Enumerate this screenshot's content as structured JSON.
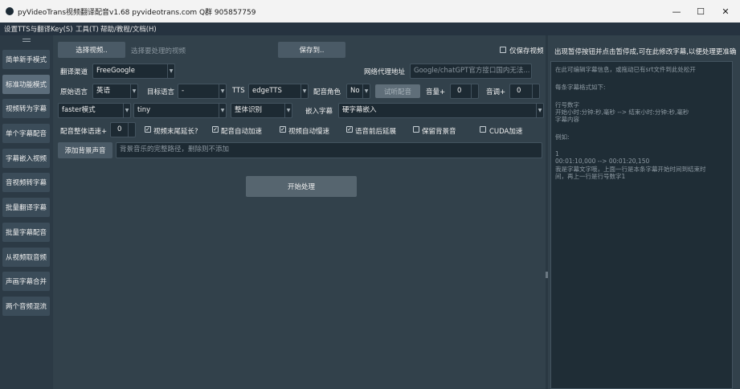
{
  "window": {
    "title": "pyVideoTrans视频翻译配音v1.68 pyvideotrans.com  Q群 905857759",
    "minimize": "—",
    "maximize": "☐",
    "close": "✕"
  },
  "menu": [
    "设置TTS与翻译Key(S)",
    "工具(T)",
    "帮助/教程/文档(H)"
  ],
  "sidebar": {
    "items": [
      {
        "label": "简单新手模式",
        "active": false
      },
      {
        "label": "标准功能模式",
        "active": true
      },
      {
        "label": "视频转为字幕",
        "active": false
      },
      {
        "label": "单个字幕配音",
        "active": false
      },
      {
        "label": "字幕嵌入视频",
        "active": false
      },
      {
        "label": "音视频转字幕",
        "active": false
      },
      {
        "label": "批量翻译字幕",
        "active": false
      },
      {
        "label": "批量字幕配音",
        "active": false
      },
      {
        "label": "从视频取音频",
        "active": false
      },
      {
        "label": "声画字幕合并",
        "active": false
      },
      {
        "label": "两个音频混流",
        "active": false
      }
    ]
  },
  "main": {
    "select_video_btn": "选择视频..",
    "select_video_hint": "选择要处理的视频",
    "save_to_btn": "保存到..",
    "save_only_label": "仅保存视频",
    "translate_channel_label": "翻译渠道",
    "translate_channel_value": "FreeGoogle",
    "proxy_label": "网络代理地址",
    "proxy_placeholder": "Google/chatGPT官方接口国内无法...",
    "source_lang_label": "原始语言",
    "source_lang_value": "英语",
    "target_lang_label": "目标语言",
    "target_lang_value": "-",
    "tts_label": "TTS",
    "tts_value": "edgeTTS",
    "voice_role_label": "配音角色",
    "voice_role_value": "No",
    "listen_btn": "试听配音",
    "volume_label": "音量+",
    "volume_value": "0",
    "pitch_label": "音调+",
    "pitch_value": "0",
    "whisper_mode_value": "faster模式",
    "model_value": "tiny",
    "recognition_value": "整体识别",
    "embed_sub_label": "嵌入字幕",
    "embed_sub_value": "硬字幕嵌入",
    "speed_label": "配音整体语速+",
    "speed_value": "0",
    "checkboxes": [
      {
        "label": "视频末尾延长?",
        "checked": true
      },
      {
        "label": "配音自动加速",
        "checked": true
      },
      {
        "label": "视频自动慢速",
        "checked": true
      },
      {
        "label": "语音前后延展",
        "checked": true
      },
      {
        "label": "保留背景音",
        "checked": false
      },
      {
        "label": "CUDA加速",
        "checked": false
      }
    ],
    "add_bgm_btn": "添加背景声音",
    "bgm_placeholder": "背景音乐的完整路径，删除则不添加",
    "start_btn": "开始处理"
  },
  "right": {
    "header": "出现暂停按钮并点击暂停成,可在此修改字幕,以便处理更准确",
    "editor_lines": [
      "在此可编辑字幕信息，或拖动已有srt文件到此处松开",
      "",
      "每条字幕格式如下:",
      "",
      "行号数字",
      "开始小时:分钟:秒,毫秒 --> 结束小时:分钟:秒,毫秒",
      "字幕内容",
      "",
      "例如:",
      "",
      "1",
      "00:01:10,000 --> 00:01:20,150",
      "我是字幕文字哦，上面一行是本条字幕开始时间到结束时",
      "间，再上一行是行号数字1"
    ]
  }
}
